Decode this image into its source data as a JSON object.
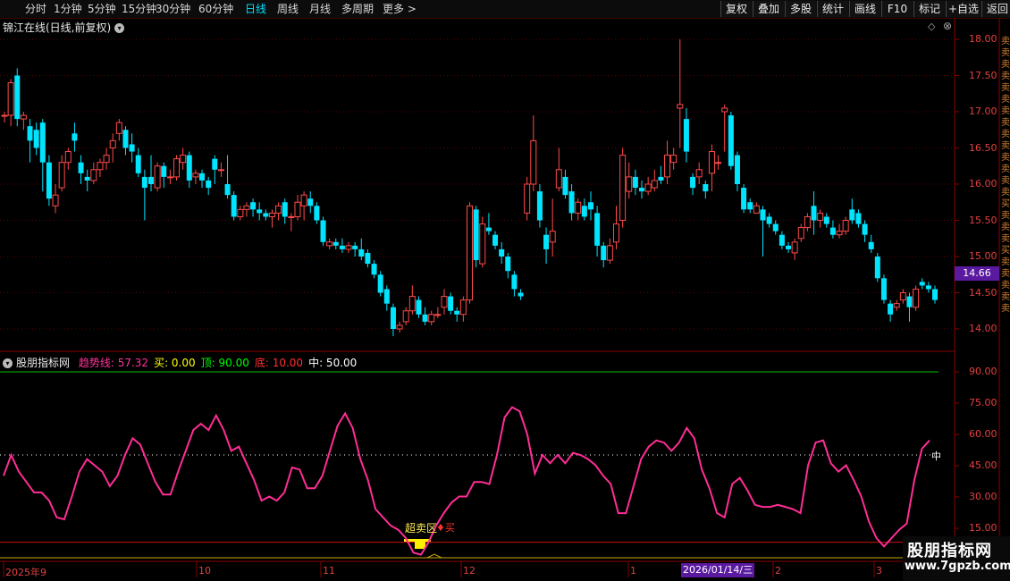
{
  "toolbar": {
    "timeframes": [
      "分时",
      "1分钟",
      "5分钟",
      "15分钟",
      "30分钟",
      "60分钟",
      "日线",
      "周线",
      "月线",
      "多周期",
      "更多"
    ],
    "active": "日线",
    "right_buttons": [
      "复权",
      "叠加",
      "多股",
      "统计",
      "画线",
      "F10",
      "标记",
      "+自选",
      "返回"
    ]
  },
  "main_chart": {
    "title": "锦江在线(日线,前复权)",
    "price_axis": [
      "18.00",
      "17.50",
      "17.00",
      "16.50",
      "16.00",
      "15.50",
      "15.00",
      "14.50",
      "14.00"
    ],
    "current_price": "14.66"
  },
  "indicator": {
    "name": "股朋指标网",
    "items": [
      {
        "label": "趋势线: 57.32",
        "color": "#ff3399"
      },
      {
        "label": "买: 0.00",
        "color": "#ffff00"
      },
      {
        "label": "顶: 90.00",
        "color": "#00ff00"
      },
      {
        "label": "底: 10.00",
        "color": "#ff3030"
      },
      {
        "label": "中: 50.00",
        "color": "#ffffff"
      }
    ],
    "axis": [
      "90.00",
      "75.00",
      "60.00",
      "45.00",
      "30.00",
      "15.00"
    ],
    "annotation": "超卖区",
    "buy_marker": "买",
    "mid_label": "中"
  },
  "dates": {
    "labels": [
      "2025年9",
      "10",
      "11",
      "12",
      "1",
      "2",
      "3"
    ],
    "cursor": "2026/01/14/三"
  },
  "watermark": {
    "line1": "股朋指标网",
    "line2": "www.7gpzb.com"
  },
  "sidebar_text": "卖卖卖卖卖卖卖卖卖卖卖卖卖卖买卖卖卖买卖卖卖卖卖",
  "colors": {
    "up": "#ff4a4a",
    "down": "#00e5ff",
    "trend": "#ff2d95",
    "grid": "#7a0000"
  },
  "chart_data": {
    "type": "candlestick",
    "price_range": [
      13.85,
      18.2
    ],
    "candles": [
      [
        16.95,
        16.95,
        16.85,
        17.0
      ],
      [
        16.95,
        17.4,
        16.8,
        17.45
      ],
      [
        17.5,
        16.9,
        16.8,
        17.6
      ],
      [
        16.9,
        16.95,
        16.75,
        17.0
      ],
      [
        16.8,
        16.6,
        16.3,
        16.9
      ],
      [
        16.75,
        16.5,
        16.4,
        16.85
      ],
      [
        16.85,
        16.3,
        15.9,
        16.9
      ],
      [
        16.3,
        15.8,
        15.7,
        16.4
      ],
      [
        15.7,
        15.85,
        15.6,
        16.0
      ],
      [
        15.95,
        16.3,
        15.9,
        16.4
      ],
      [
        16.3,
        16.45,
        16.2,
        16.5
      ],
      [
        16.7,
        16.6,
        16.45,
        16.85
      ],
      [
        16.3,
        16.15,
        16.0,
        16.4
      ],
      [
        16.1,
        16.05,
        15.9,
        16.2
      ],
      [
        16.05,
        16.2,
        16.0,
        16.3
      ],
      [
        16.2,
        16.3,
        16.1,
        16.35
      ],
      [
        16.3,
        16.4,
        16.2,
        16.5
      ],
      [
        16.5,
        16.6,
        16.3,
        16.7
      ],
      [
        16.7,
        16.85,
        16.6,
        16.9
      ],
      [
        16.75,
        16.5,
        16.4,
        16.8
      ],
      [
        16.55,
        16.45,
        16.3,
        16.7
      ],
      [
        16.4,
        16.15,
        16.1,
        16.5
      ],
      [
        16.1,
        15.95,
        15.5,
        16.2
      ],
      [
        16.1,
        16.0,
        15.9,
        16.4
      ],
      [
        15.95,
        16.25,
        15.9,
        16.3
      ],
      [
        16.25,
        16.1,
        15.95,
        16.3
      ],
      [
        16.1,
        16.1,
        16.0,
        16.2
      ],
      [
        16.1,
        16.35,
        16.05,
        16.4
      ],
      [
        16.3,
        16.4,
        16.2,
        16.5
      ],
      [
        16.4,
        16.05,
        15.95,
        16.45
      ],
      [
        16.1,
        16.15,
        16.0,
        16.2
      ],
      [
        16.15,
        16.05,
        15.95,
        16.2
      ],
      [
        16.05,
        15.95,
        15.85,
        16.1
      ],
      [
        16.35,
        16.2,
        16.0,
        16.4
      ],
      [
        16.2,
        16.2,
        16.1,
        16.3
      ],
      [
        16.0,
        15.85,
        15.8,
        16.4
      ],
      [
        15.85,
        15.55,
        15.5,
        15.9
      ],
      [
        15.55,
        15.65,
        15.5,
        15.7
      ],
      [
        15.65,
        15.7,
        15.55,
        15.75
      ],
      [
        15.75,
        15.65,
        15.55,
        15.8
      ],
      [
        15.65,
        15.6,
        15.5,
        15.75
      ],
      [
        15.6,
        15.55,
        15.5,
        15.65
      ],
      [
        15.55,
        15.6,
        15.4,
        15.65
      ],
      [
        15.6,
        15.7,
        15.5,
        15.75
      ],
      [
        15.75,
        15.55,
        15.45,
        15.8
      ],
      [
        15.55,
        15.55,
        15.35,
        15.6
      ],
      [
        15.55,
        15.75,
        15.5,
        15.85
      ],
      [
        15.7,
        15.85,
        15.5,
        15.9
      ],
      [
        15.8,
        15.7,
        15.6,
        15.9
      ],
      [
        15.7,
        15.5,
        15.45,
        15.75
      ],
      [
        15.5,
        15.2,
        15.15,
        15.55
      ],
      [
        15.15,
        15.2,
        15.1,
        15.25
      ],
      [
        15.2,
        15.15,
        15.1,
        15.25
      ],
      [
        15.15,
        15.1,
        15.05,
        15.25
      ],
      [
        15.1,
        15.15,
        15.05,
        15.2
      ],
      [
        15.15,
        15.1,
        15.0,
        15.2
      ],
      [
        15.1,
        15.0,
        14.95,
        15.25
      ],
      [
        15.05,
        14.9,
        14.85,
        15.1
      ],
      [
        14.9,
        14.75,
        14.7,
        14.95
      ],
      [
        14.75,
        14.5,
        14.45,
        14.8
      ],
      [
        14.55,
        14.35,
        14.25,
        14.6
      ],
      [
        14.3,
        14.0,
        13.9,
        14.35
      ],
      [
        14.0,
        14.05,
        13.95,
        14.1
      ],
      [
        14.1,
        14.25,
        14.05,
        14.3
      ],
      [
        14.25,
        14.45,
        14.2,
        14.6
      ],
      [
        14.4,
        14.2,
        14.15,
        14.45
      ],
      [
        14.2,
        14.1,
        14.05,
        14.3
      ],
      [
        14.1,
        14.2,
        14.05,
        14.25
      ],
      [
        14.2,
        14.2,
        14.15,
        14.3
      ],
      [
        14.3,
        14.45,
        14.2,
        14.55
      ],
      [
        14.45,
        14.25,
        14.2,
        14.5
      ],
      [
        14.25,
        14.2,
        14.1,
        14.3
      ],
      [
        14.2,
        14.4,
        14.1,
        14.45
      ],
      [
        14.4,
        15.7,
        14.35,
        15.75
      ],
      [
        15.65,
        14.95,
        14.85,
        15.7
      ],
      [
        14.9,
        15.45,
        14.85,
        15.55
      ],
      [
        15.4,
        15.35,
        15.3,
        15.6
      ],
      [
        15.3,
        15.15,
        15.1,
        15.35
      ],
      [
        15.1,
        15.0,
        14.9,
        15.2
      ],
      [
        15.0,
        14.8,
        14.7,
        15.05
      ],
      [
        14.75,
        14.55,
        14.45,
        14.8
      ],
      [
        14.5,
        14.45,
        14.4,
        14.55
      ],
      [
        15.6,
        16.0,
        15.5,
        16.1
      ],
      [
        16.0,
        16.6,
        15.9,
        16.95
      ],
      [
        15.9,
        15.5,
        15.4,
        16.0
      ],
      [
        15.3,
        15.1,
        14.9,
        15.4
      ],
      [
        15.2,
        15.35,
        15.0,
        15.8
      ],
      [
        15.95,
        16.2,
        15.9,
        16.5
      ],
      [
        16.1,
        15.85,
        15.8,
        16.2
      ],
      [
        15.9,
        15.6,
        15.5,
        16.0
      ],
      [
        15.6,
        15.75,
        15.5,
        15.8
      ],
      [
        15.7,
        15.55,
        15.5,
        15.8
      ],
      [
        15.75,
        15.65,
        15.5,
        15.9
      ],
      [
        15.6,
        15.15,
        15.0,
        15.7
      ],
      [
        15.15,
        14.95,
        14.85,
        15.2
      ],
      [
        14.95,
        15.15,
        14.9,
        15.25
      ],
      [
        15.2,
        15.45,
        15.1,
        15.7
      ],
      [
        15.5,
        16.4,
        15.4,
        16.5
      ],
      [
        15.9,
        16.1,
        15.8,
        16.3
      ],
      [
        16.1,
        15.95,
        15.85,
        16.2
      ],
      [
        15.95,
        15.9,
        15.8,
        16.05
      ],
      [
        15.9,
        16.0,
        15.85,
        16.1
      ],
      [
        15.95,
        16.05,
        15.9,
        16.2
      ],
      [
        16.1,
        16.05,
        16.0,
        16.25
      ],
      [
        16.1,
        16.4,
        16.0,
        16.6
      ],
      [
        16.3,
        16.4,
        16.2,
        16.5
      ],
      [
        17.05,
        17.1,
        16.5,
        18.0
      ],
      [
        16.9,
        16.45,
        16.3,
        17.05
      ],
      [
        16.1,
        15.95,
        15.85,
        16.15
      ],
      [
        16.1,
        16.2,
        16.0,
        16.3
      ],
      [
        16.0,
        15.9,
        15.8,
        16.05
      ],
      [
        16.15,
        16.45,
        15.9,
        16.55
      ],
      [
        16.3,
        16.3,
        16.2,
        16.4
      ],
      [
        17.0,
        17.05,
        16.45,
        17.1
      ],
      [
        16.95,
        16.25,
        16.2,
        17.0
      ],
      [
        16.4,
        16.0,
        15.9,
        16.45
      ],
      [
        15.95,
        15.65,
        15.6,
        16.0
      ],
      [
        15.75,
        15.65,
        15.6,
        15.8
      ],
      [
        15.6,
        15.7,
        15.6,
        15.75
      ],
      [
        15.65,
        15.5,
        15.0,
        15.7
      ],
      [
        15.55,
        15.45,
        15.4,
        15.6
      ],
      [
        15.45,
        15.35,
        15.3,
        15.5
      ],
      [
        15.3,
        15.15,
        15.1,
        15.35
      ],
      [
        15.15,
        15.1,
        15.05,
        15.2
      ],
      [
        15.05,
        15.2,
        14.95,
        15.25
      ],
      [
        15.25,
        15.4,
        15.2,
        15.45
      ],
      [
        15.4,
        15.55,
        15.35,
        15.6
      ],
      [
        15.7,
        15.5,
        15.3,
        15.9
      ],
      [
        15.5,
        15.6,
        15.4,
        15.65
      ],
      [
        15.55,
        15.45,
        15.4,
        15.6
      ],
      [
        15.4,
        15.3,
        15.25,
        15.5
      ],
      [
        15.3,
        15.35,
        15.25,
        15.45
      ],
      [
        15.35,
        15.5,
        15.3,
        15.55
      ],
      [
        15.65,
        15.5,
        15.45,
        15.8
      ],
      [
        15.6,
        15.45,
        15.4,
        15.65
      ],
      [
        15.45,
        15.3,
        15.2,
        15.5
      ],
      [
        15.2,
        15.1,
        15.05,
        15.3
      ],
      [
        15.0,
        14.7,
        14.65,
        15.05
      ],
      [
        14.7,
        14.4,
        14.35,
        14.75
      ],
      [
        14.35,
        14.2,
        14.1,
        14.4
      ],
      [
        14.3,
        14.35,
        14.25,
        14.4
      ],
      [
        14.4,
        14.5,
        14.35,
        14.55
      ],
      [
        14.45,
        14.3,
        14.1,
        14.5
      ],
      [
        14.3,
        14.55,
        14.25,
        14.6
      ],
      [
        14.65,
        14.6,
        14.55,
        14.7
      ],
      [
        14.6,
        14.55,
        14.5,
        14.65
      ],
      [
        14.55,
        14.4,
        14.35,
        14.6
      ]
    ],
    "trend_line": [
      40,
      50,
      42,
      37,
      32,
      32,
      28,
      20,
      19,
      30,
      42,
      48,
      45,
      42,
      35,
      40,
      50,
      58,
      55,
      46,
      37,
      31,
      31,
      42,
      52,
      62,
      65,
      62,
      69,
      62,
      52,
      54,
      46,
      38,
      28,
      30,
      28,
      32,
      44,
      43,
      34,
      34,
      40,
      52,
      64,
      70,
      63,
      48,
      38,
      24,
      20,
      16,
      14,
      10,
      3,
      2,
      8,
      16,
      22,
      27,
      30,
      30,
      37,
      37,
      36,
      50,
      68,
      73,
      71,
      60,
      41,
      50,
      46,
      50,
      46,
      51,
      50,
      48,
      45,
      40,
      36,
      22,
      22,
      35,
      48,
      54,
      57,
      56,
      52,
      56,
      63,
      58,
      43,
      34,
      22,
      20,
      36,
      39,
      33,
      26,
      25,
      25,
      26,
      25,
      24,
      22,
      45,
      56,
      57,
      46,
      42,
      45,
      38,
      30,
      18,
      10,
      6,
      10,
      14,
      17,
      38,
      53,
      57
    ]
  }
}
